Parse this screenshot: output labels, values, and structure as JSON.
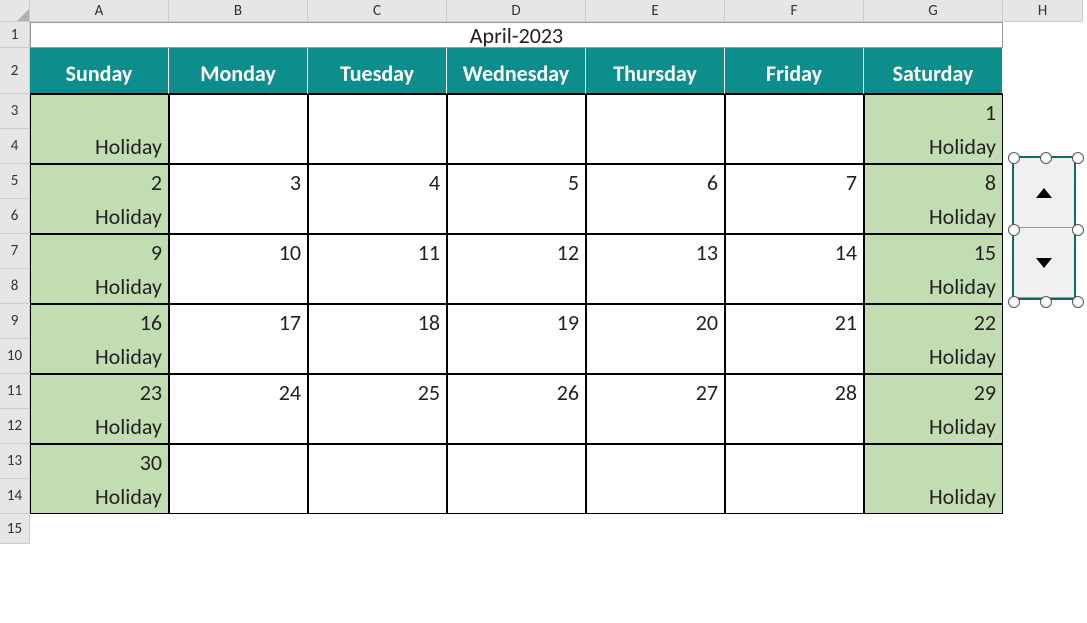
{
  "columns": [
    "A",
    "B",
    "C",
    "D",
    "E",
    "F",
    "G",
    "H"
  ],
  "rows": [
    "1",
    "2",
    "3",
    "4",
    "5",
    "6",
    "7",
    "8",
    "9",
    "10",
    "11",
    "12",
    "13",
    "14",
    "15"
  ],
  "title": "April-2023",
  "dayheaders": [
    "Sunday",
    "Monday",
    "Tuesday",
    "Wednesday",
    "Thursday",
    "Friday",
    "Saturday"
  ],
  "weeks": [
    {
      "dates": [
        "",
        "",
        "",
        "",
        "",
        "",
        "1"
      ],
      "labels": [
        "Holiday",
        "",
        "",
        "",
        "",
        "",
        "Holiday"
      ]
    },
    {
      "dates": [
        "2",
        "3",
        "4",
        "5",
        "6",
        "7",
        "8"
      ],
      "labels": [
        "Holiday",
        "",
        "",
        "",
        "",
        "",
        "Holiday"
      ]
    },
    {
      "dates": [
        "9",
        "10",
        "11",
        "12",
        "13",
        "14",
        "15"
      ],
      "labels": [
        "Holiday",
        "",
        "",
        "",
        "",
        "",
        "Holiday"
      ]
    },
    {
      "dates": [
        "16",
        "17",
        "18",
        "19",
        "20",
        "21",
        "22"
      ],
      "labels": [
        "Holiday",
        "",
        "",
        "",
        "",
        "",
        "Holiday"
      ]
    },
    {
      "dates": [
        "23",
        "24",
        "25",
        "26",
        "27",
        "28",
        "29"
      ],
      "labels": [
        "Holiday",
        "",
        "",
        "",
        "",
        "",
        "Holiday"
      ]
    },
    {
      "dates": [
        "30",
        "",
        "",
        "",
        "",
        "",
        ""
      ],
      "labels": [
        "Holiday",
        "",
        "",
        "",
        "",
        "",
        "Holiday"
      ]
    }
  ],
  "spinner": {
    "up": "▲",
    "down": "▼"
  }
}
